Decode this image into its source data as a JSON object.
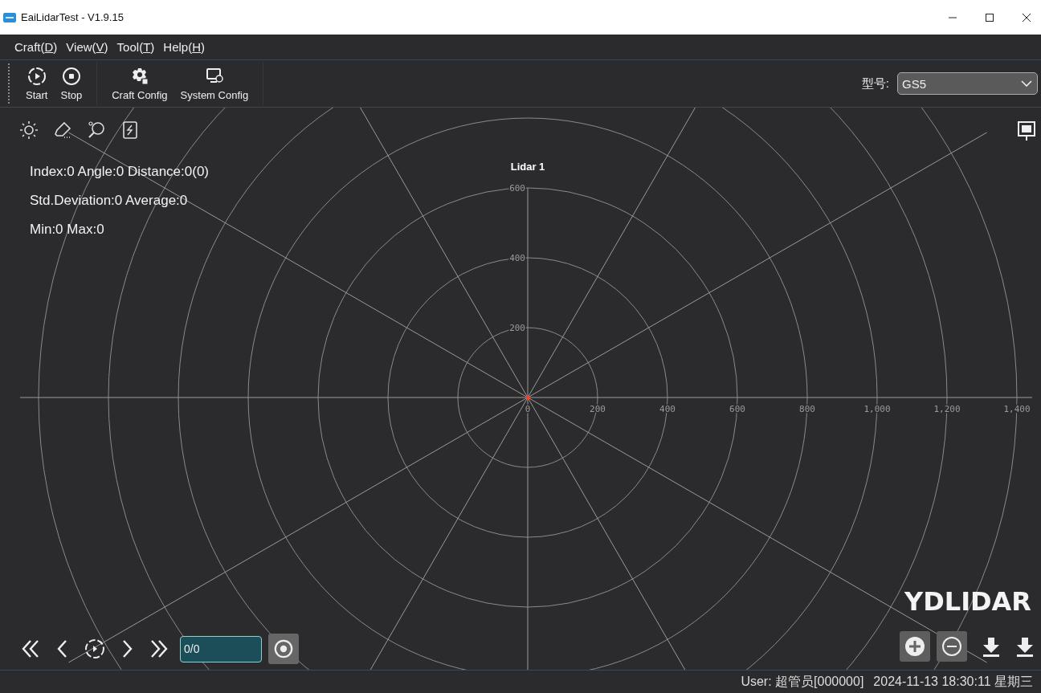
{
  "window": {
    "title": "EaiLidarTest - V1.9.15"
  },
  "menu": [
    {
      "before": "Craft(",
      "mnemonic": "D",
      "after": ")"
    },
    {
      "before": "View(",
      "mnemonic": "V",
      "after": ")"
    },
    {
      "before": "Tool(",
      "mnemonic": "T",
      "after": ")"
    },
    {
      "before": "Help(",
      "mnemonic": "H",
      "after": ")"
    }
  ],
  "toolbar": {
    "groups": [
      [
        {
          "kind": "start",
          "label": "Start"
        },
        {
          "kind": "stop",
          "label": "Stop"
        }
      ],
      [
        {
          "kind": "craft",
          "label": "Craft Config"
        },
        {
          "kind": "system",
          "label": "System Config"
        }
      ]
    ],
    "model_label": "型号:",
    "model_value": "GS5"
  },
  "plot": {
    "title": "Lidar 1",
    "info": [
      "Index:0 Angle:0 Distance:0(0)",
      "Std.Deviation:0 Average:0",
      "Min:0 Max:0"
    ],
    "x_ticks": [
      "0",
      "200",
      "400",
      "600",
      "800",
      "1,000",
      "1,200",
      "1,400"
    ],
    "y_ticks": [
      "600",
      "400",
      "200"
    ],
    "logo": "YDLIDAR"
  },
  "playback": {
    "frame": "0/0"
  },
  "status_bar": {
    "user": "User: 超管员[000000]",
    "datetime": "2024-11-13 18:30:11 星期三"
  }
}
